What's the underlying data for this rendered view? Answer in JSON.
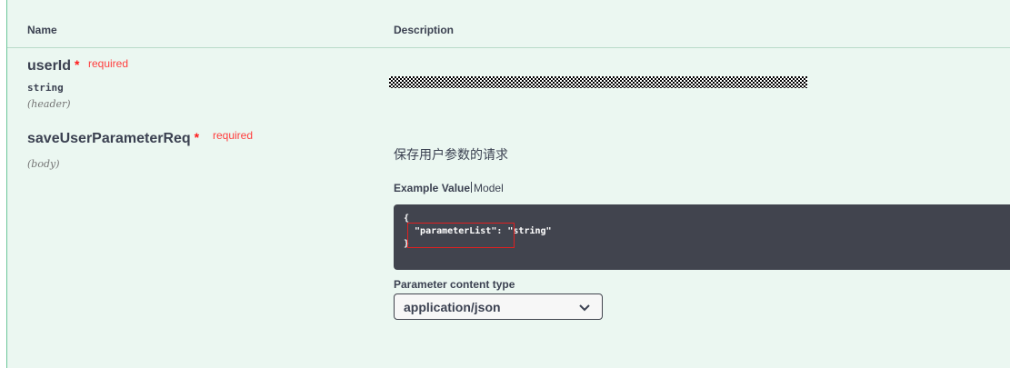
{
  "headers": {
    "name": "Name",
    "description": "Description"
  },
  "params": [
    {
      "name": "userId",
      "required_star": "*",
      "required_label": "required",
      "type": "string",
      "in": "(header)"
    },
    {
      "name": "saveUserParameterReq",
      "required_star": "*",
      "required_label": "required",
      "in": "(body)"
    }
  ],
  "body_param": {
    "description": "保存用户参数的请求",
    "tab_example": "Example Value",
    "tab_model": "Model",
    "example_lines": [
      "{",
      "  \"parameterList\": \"string\"",
      "}"
    ],
    "content_type_label": "Parameter content type",
    "content_type_value": "application/json"
  },
  "colors": {
    "panel_bg": "#ebf7f1",
    "required": "#ff3d3d",
    "code_bg": "#41444e",
    "highlight_box": "#e02020"
  }
}
